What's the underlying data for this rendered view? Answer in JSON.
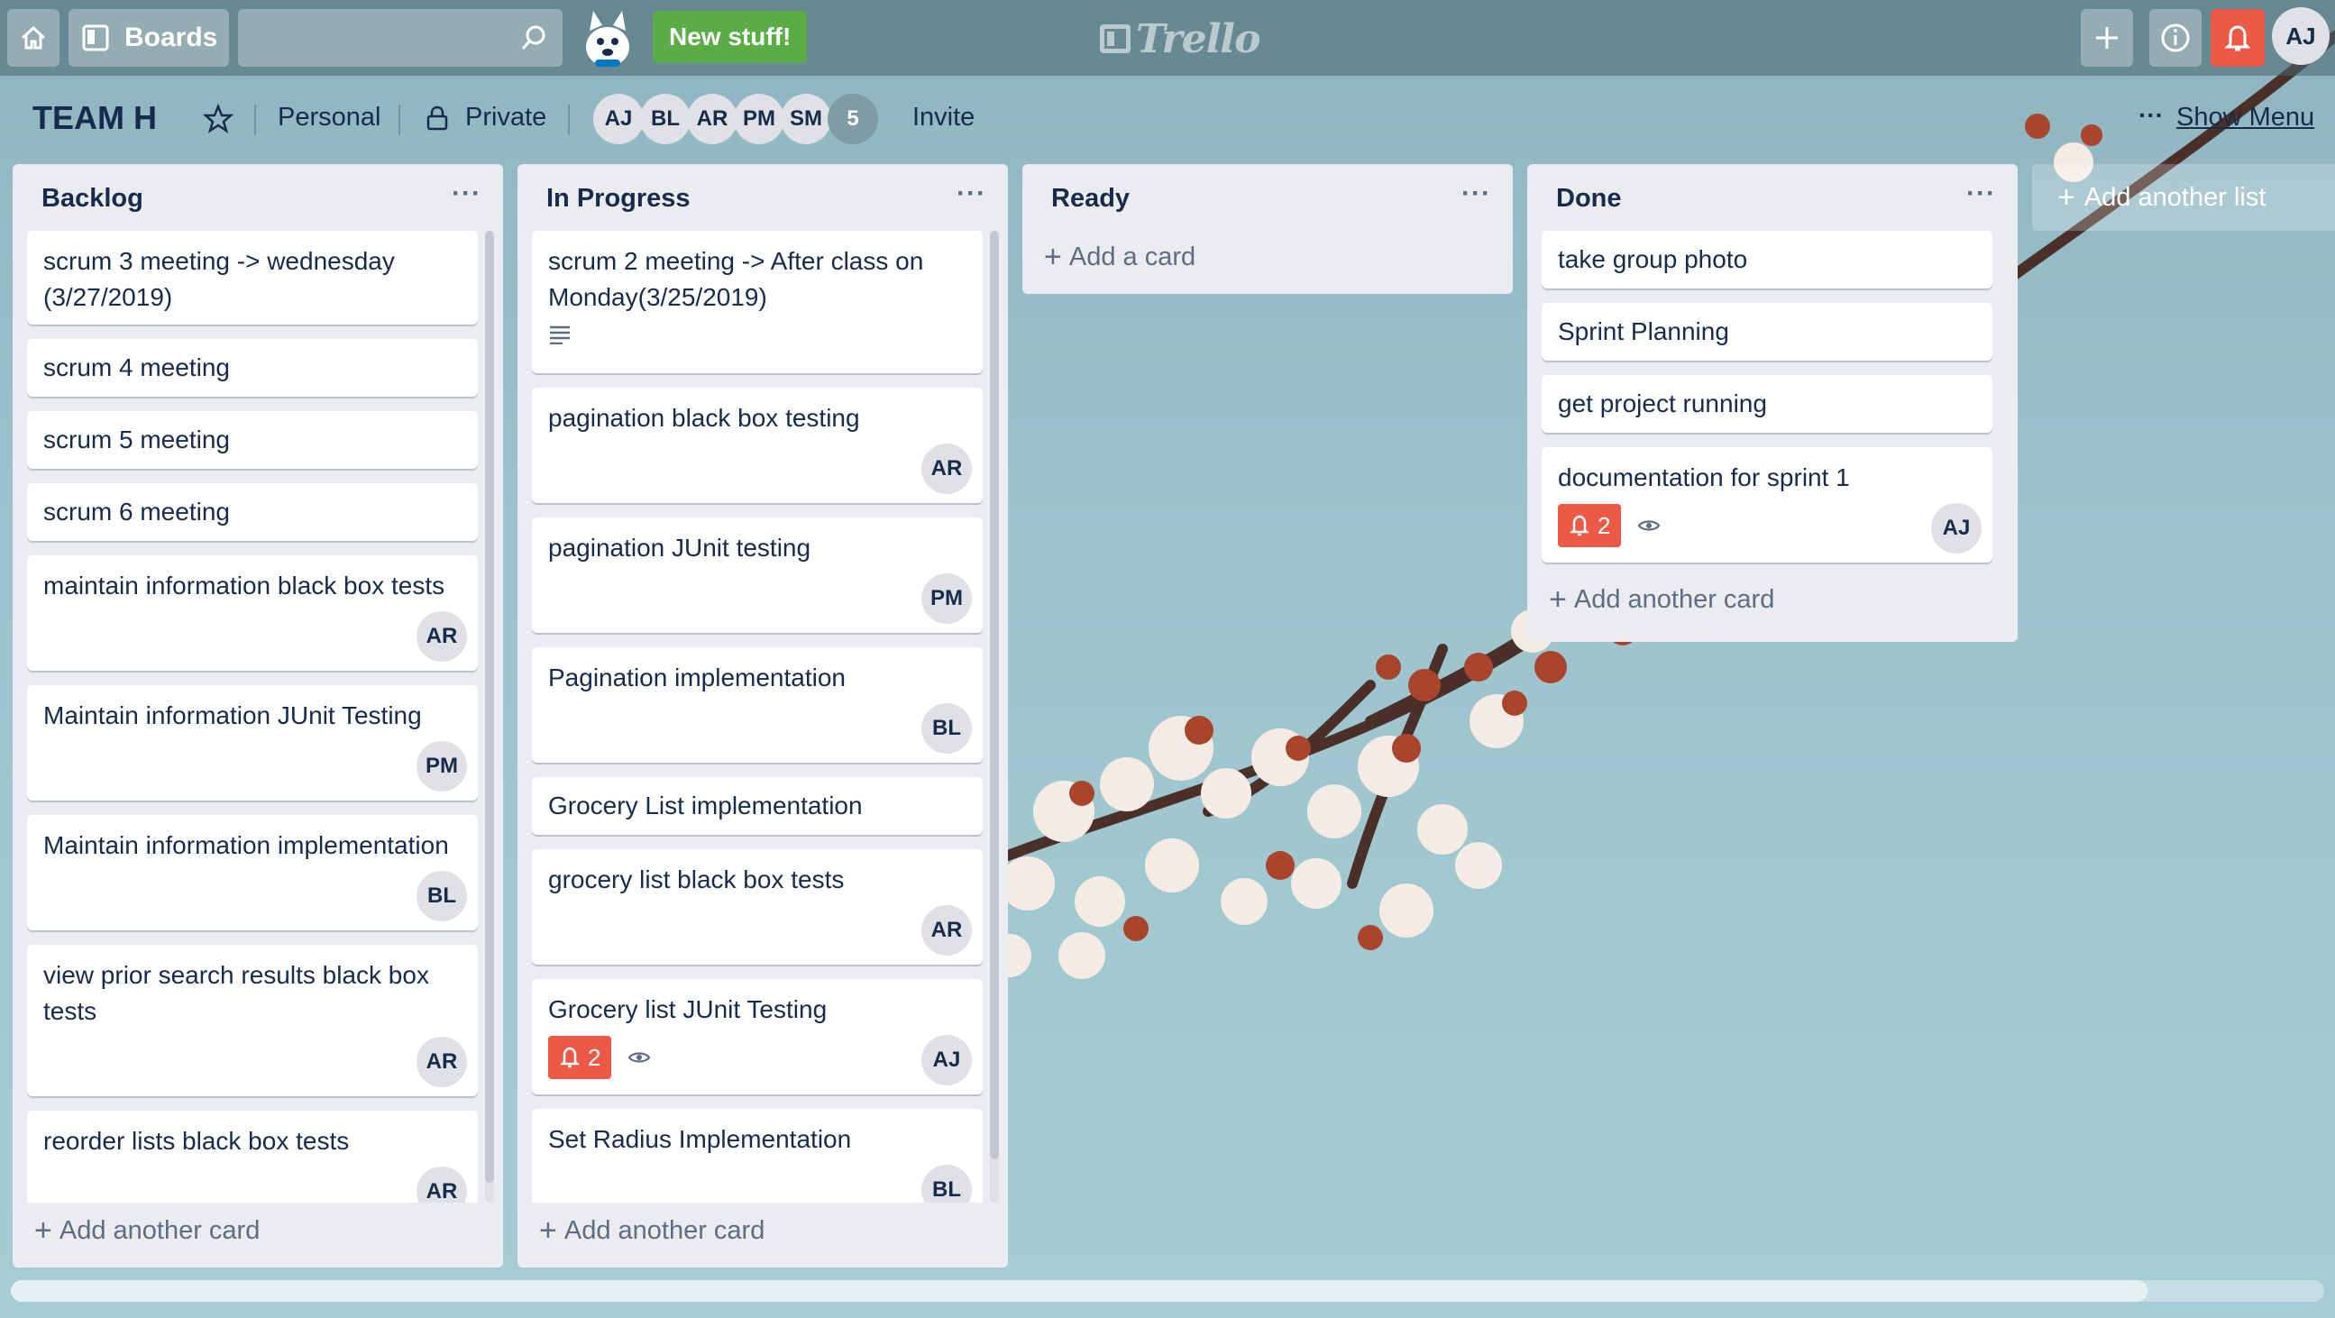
{
  "header": {
    "boards_label": "Boards",
    "search_placeholder": "",
    "new_stuff_label": "New stuff!",
    "logo_text": "Trello",
    "user_initials": "AJ"
  },
  "board": {
    "title": "TEAM H",
    "team_label": "Personal",
    "visibility_label": "Private",
    "members": [
      "AJ",
      "BL",
      "AR",
      "PM",
      "SM"
    ],
    "member_overflow": "5",
    "invite_label": "Invite",
    "show_menu_label": "Show Menu"
  },
  "lists": [
    {
      "title": "Backlog",
      "add_label": "Add another card",
      "cards": [
        {
          "title": "scrum 3 meeting -> wednesday (3/27/2019)"
        },
        {
          "title": "scrum 4 meeting"
        },
        {
          "title": "scrum 5 meeting"
        },
        {
          "title": "scrum 6 meeting"
        },
        {
          "title": "maintain information black box tests",
          "member": "AR"
        },
        {
          "title": "Maintain information JUnit Testing",
          "member": "PM"
        },
        {
          "title": "Maintain information implementation",
          "member": "BL"
        },
        {
          "title": "view prior search results black box tests",
          "member": "AR"
        },
        {
          "title": "reorder lists black box tests",
          "member": "AR"
        }
      ]
    },
    {
      "title": "In Progress",
      "add_label": "Add another card",
      "cards": [
        {
          "title": "scrum 2 meeting -> After class on Monday(3/25/2019)",
          "has_description": true
        },
        {
          "title": "pagination black box testing",
          "member": "AR"
        },
        {
          "title": "pagination JUnit testing",
          "member": "PM"
        },
        {
          "title": "Pagination implementation",
          "member": "BL"
        },
        {
          "title": "Grocery List implementation"
        },
        {
          "title": "grocery list black box tests",
          "member": "AR"
        },
        {
          "title": "Grocery list JUnit Testing",
          "member": "AJ",
          "due_count": "2",
          "watched": true
        },
        {
          "title": "Set Radius Implementation",
          "member": "BL"
        }
      ]
    },
    {
      "title": "Ready",
      "add_label": "Add a card",
      "cards": []
    },
    {
      "title": "Done",
      "add_label": "Add another card",
      "cards": [
        {
          "title": "take group photo"
        },
        {
          "title": "Sprint Planning"
        },
        {
          "title": "get project running"
        },
        {
          "title": "documentation for sprint 1",
          "member": "AJ",
          "due_count": "2",
          "watched": true
        }
      ]
    }
  ],
  "add_list_label": "Add another list",
  "colors": {
    "due_badge": "#eb5a46",
    "new_stuff": "#5aac44",
    "notification": "#eb5a46",
    "list_bg": "#ebecf0",
    "text": "#172b4d"
  },
  "icons": [
    "home-icon",
    "boards-icon",
    "search-icon",
    "mascot-icon",
    "trello-logo-icon",
    "plus-icon",
    "info-icon",
    "bell-icon",
    "star-icon",
    "lock-icon",
    "description-icon",
    "due-bell-icon",
    "watch-eye-icon"
  ]
}
